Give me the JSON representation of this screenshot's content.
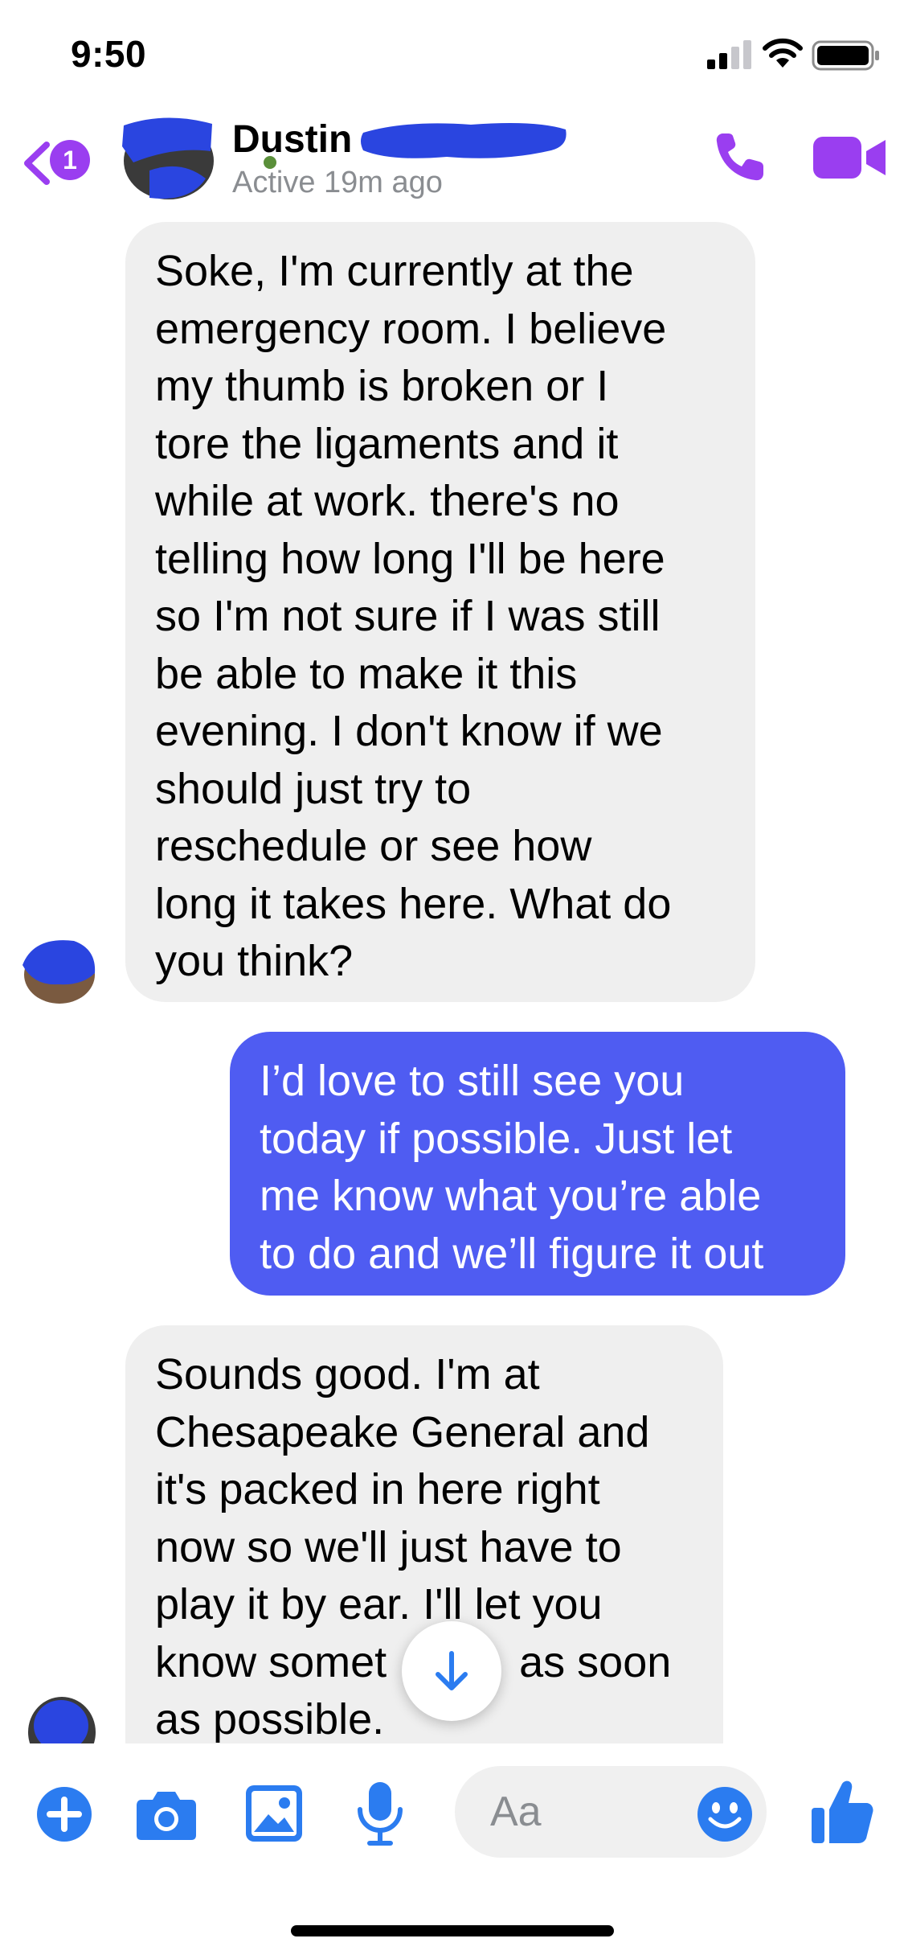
{
  "status_bar": {
    "time": "9:50"
  },
  "header": {
    "back_badge": "1",
    "contact_name": "Dustin",
    "active_status": "Active 19m ago"
  },
  "messages": [
    {
      "direction": "incoming",
      "lines": [
        "Soke, I'm currently at the",
        "emergency room. I believe",
        "my thumb is broken or I",
        "tore the ligaments and it",
        "while at work. there's no",
        "telling how long I'll be here",
        "so I'm not sure if I was still",
        "be able to make it this",
        "evening. I don't know if we",
        "should just try to",
        "reschedule or see how",
        "long it takes here. What do",
        "you think?"
      ]
    },
    {
      "direction": "outgoing",
      "lines": [
        "I’d love to still see you",
        "today if possible. Just let",
        "me know what you’re able",
        "to do and we’ll figure it out"
      ]
    },
    {
      "direction": "incoming",
      "lines": [
        "Sounds good. I'm at",
        "Chesapeake General and",
        "it's packed in here right",
        "now so we'll just have to",
        "play it by ear. I'll let you",
        "know somet           as soon",
        "as possible."
      ]
    }
  ],
  "composer": {
    "placeholder": "Aa"
  },
  "icons": {
    "back": "chevron-left-icon",
    "call": "phone-icon",
    "video": "video-camera-icon",
    "scroll": "arrow-down-icon",
    "plus": "plus-icon",
    "camera": "camera-icon",
    "gallery": "image-icon",
    "mic": "microphone-icon",
    "emoji": "emoji-icon",
    "like": "thumbs-up-icon"
  },
  "colors": {
    "accent_purple": "#9a3ef0",
    "outgoing_bubble": "#4f5cf2",
    "incoming_bubble": "#efefef",
    "composer_blue": "#2b7cf0"
  }
}
